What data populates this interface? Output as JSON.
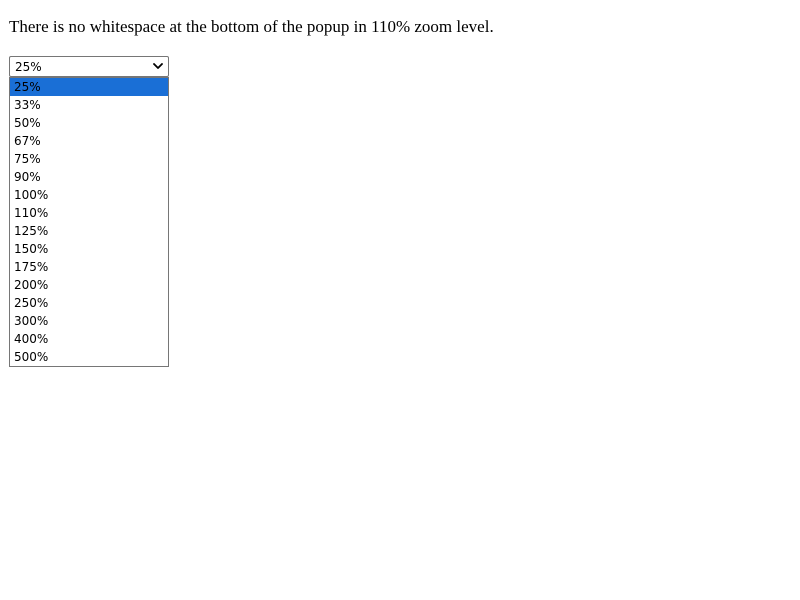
{
  "heading": "There is no whitespace at the bottom of the popup in 110% zoom level.",
  "zoom_select": {
    "value": "25%",
    "icon": "chevron-down-icon",
    "options": [
      "25%",
      "33%",
      "50%",
      "67%",
      "75%",
      "90%",
      "100%",
      "110%",
      "125%",
      "150%",
      "175%",
      "200%",
      "250%",
      "300%",
      "400%",
      "500%"
    ],
    "highlighted_index": 0,
    "highlight_color": "#1a6fd6"
  }
}
